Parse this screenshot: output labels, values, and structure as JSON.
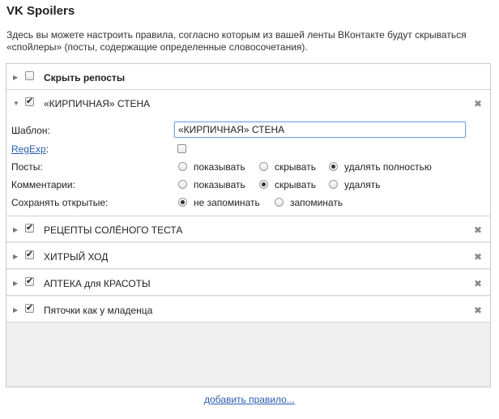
{
  "app_title": "VK Spoilers",
  "description": "Здесь вы можете настроить правила, согласно которым из вашей ленты ВКонтакте будут скрываться «спойлеры» (посты, содержащие определенные словосочетания).",
  "hide_reposts": {
    "label": "Скрыть репосты",
    "checked": false
  },
  "expanded_rule": {
    "title": "«КИРПИЧНАЯ» СТЕНА",
    "checked": true,
    "template_label": "Шаблон:",
    "template_value": "«КИРПИЧНАЯ» СТЕНА",
    "regexp_label": "RegExp",
    "regexp_colon": ":",
    "regexp_checked": false,
    "posts_label": "Посты:",
    "posts_options": [
      "показывать",
      "скрывать",
      "удалять полностью"
    ],
    "posts_selected": 2,
    "comments_label": "Комментарии:",
    "comments_options": [
      "показывать",
      "скрывать",
      "удалять"
    ],
    "comments_selected": 1,
    "save_label": "Сохранять открытые:",
    "save_options": [
      "не запоминать",
      "запоминать"
    ],
    "save_selected": 0
  },
  "rules": [
    {
      "title": "РЕЦЕПТЫ СОЛЁНОГО ТЕСТА",
      "checked": true
    },
    {
      "title": "ХИТРЫЙ ХОД",
      "checked": true
    },
    {
      "title": "АПТЕКА для КРАСОТЫ",
      "checked": true
    },
    {
      "title": "Пяточки как у младенца",
      "checked": true
    }
  ],
  "icons": {
    "collapsed_arrow": "triangle-right-icon",
    "expanded_arrow": "triangle-down-icon",
    "delete": "close-icon"
  },
  "add_rule_link": "добавить правило..."
}
